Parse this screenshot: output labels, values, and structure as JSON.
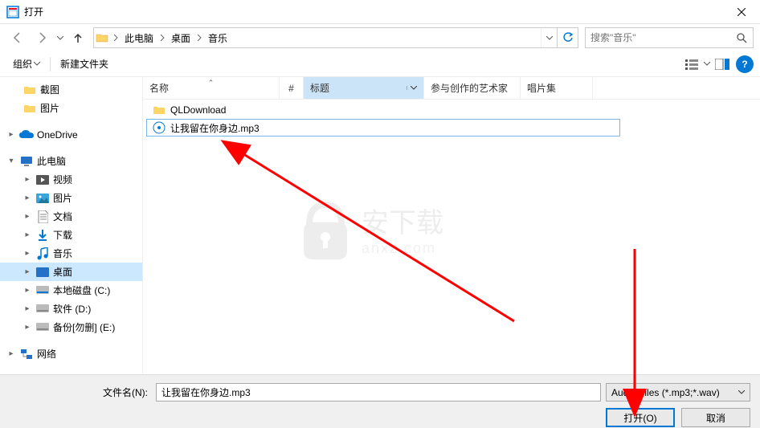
{
  "window": {
    "title": "打开"
  },
  "breadcrumbs": {
    "pc": "此电脑",
    "desktop": "桌面",
    "music": "音乐"
  },
  "search": {
    "placeholder": "搜索\"音乐\""
  },
  "toolbar": {
    "organize": "组织",
    "newfolder": "新建文件夹"
  },
  "columns": {
    "name": "名称",
    "number": "#",
    "title": "标题",
    "artist": "参与创作的艺术家",
    "album": "唱片集"
  },
  "sidebar": {
    "jietu": "截图",
    "tupian": "图片",
    "onedrive": "OneDrive",
    "pc": "此电脑",
    "video": "视频",
    "pictures": "图片",
    "docs": "文档",
    "downloads": "下载",
    "music": "音乐",
    "desktop": "桌面",
    "disk_c": "本地磁盘 (C:)",
    "disk_d": "软件 (D:)",
    "disk_e": "备份[勿删] (E:)",
    "network": "网络"
  },
  "files": {
    "folder1": "QLDownload",
    "file1": "让我留在你身边.mp3"
  },
  "footer": {
    "filename_label": "文件名(N):",
    "filename_value": "让我留在你身边.mp3",
    "filter": "Audio Files (*.mp3;*.wav)",
    "open": "打开(O)",
    "cancel": "取消"
  },
  "watermark": {
    "big": "安下载",
    "small": "anxz.com"
  }
}
